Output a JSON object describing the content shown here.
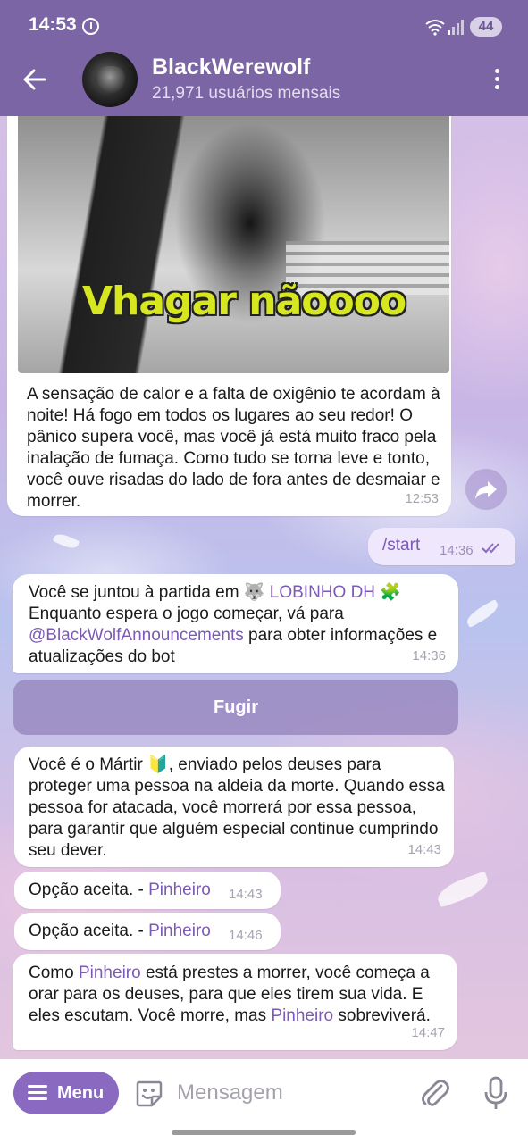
{
  "status_bar": {
    "time": "14:53",
    "battery": "44"
  },
  "header": {
    "title": "BlackWerewolf",
    "subtitle": "21,971 usuários mensais"
  },
  "messages": {
    "media": {
      "caption_overlay": "Vhagar nãoooo",
      "text": "A sensação de calor e a falta de oxigênio te acordam à noite! Há fogo em todos os lugares ao seu redor! O pânico supera você, mas você já está muito fraco pela inalação de fumaça. Como tudo se torna leve e tonto, você ouve risadas do lado de fora antes de desmaiar e morrer.",
      "time": "12:53"
    },
    "outgoing": {
      "text": "/start",
      "time": "14:36"
    },
    "join": {
      "text_1": "Você se juntou à partida em 🐺 ",
      "link_game": "LOBINHO DH",
      "text_2": " 🧩 Enquanto espera o jogo começar, vá para ",
      "link_channel": "@BlackWolfAnnouncements",
      "text_3": " para obter informações e atualizações do bot",
      "time": "14:36"
    },
    "keyboard_button": "Fugir",
    "role": {
      "text": "Você é o Mártir 🔰, enviado pelos deuses para proteger uma pessoa na aldeia da morte. Quando essa pessoa for atacada, você morrerá por essa pessoa, para garantir que alguém especial continue cumprindo seu dever.",
      "time": "14:43"
    },
    "option_1": {
      "text": "Opção aceita. - ",
      "name": "Pinheiro",
      "time": "14:43"
    },
    "option_2": {
      "text": "Opção aceita. - ",
      "name": "Pinheiro",
      "time": "14:46"
    },
    "final": {
      "text_1": "Como ",
      "name_1": "Pinheiro",
      "text_2": " está prestes a morrer, você começa a orar para os deuses, para que eles tirem sua vida. E eles escutam. Você morre, mas ",
      "name_2": "Pinheiro",
      "text_3": " sobreviverá.",
      "time": "14:47"
    }
  },
  "input_bar": {
    "menu_label": "Menu",
    "placeholder": "Mensagem"
  },
  "colors": {
    "header": "#7b65a4",
    "accent": "#8a6ac0",
    "link": "#7b59b5"
  }
}
